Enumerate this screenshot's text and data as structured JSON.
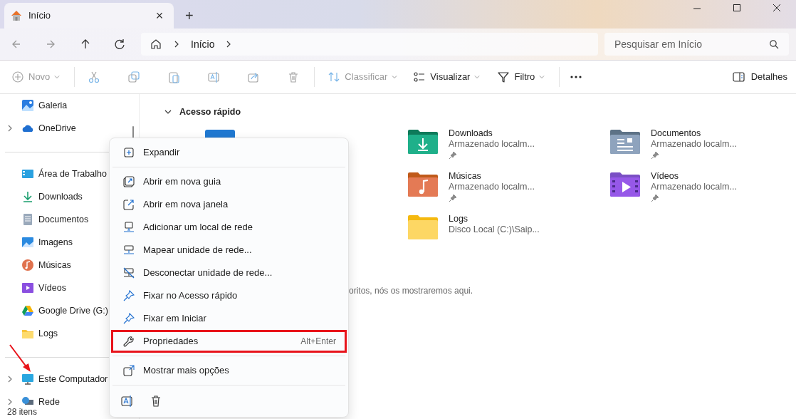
{
  "tab": {
    "title": "Início",
    "close": "×"
  },
  "new_tab": "+",
  "address": {
    "crumbs": [
      "Início"
    ]
  },
  "search": {
    "placeholder": "Pesquisar em Início"
  },
  "toolbar": [
    {
      "label": "Novo",
      "disabled": true,
      "dropdown": true
    },
    {
      "disabled": true,
      "dropdown": false
    },
    {
      "disabled": true,
      "dropdown": false
    },
    {
      "disabled": true,
      "dropdown": false
    },
    {
      "disabled": true,
      "dropdown": false
    },
    {
      "disabled": true,
      "dropdown": false
    },
    {
      "disabled": true,
      "dropdown": false
    },
    {
      "label": "Classificar",
      "disabled": true,
      "dropdown": true
    },
    {
      "label": "Visualizar",
      "disabled": false,
      "dropdown": true
    },
    {
      "label": "Filtro",
      "disabled": false,
      "dropdown": true
    }
  ],
  "details_button": "Detalhes",
  "sidebar": {
    "groups": [
      [
        {
          "label": "Galeria",
          "expandable": false
        },
        {
          "label": "OneDrive",
          "expandable": true
        }
      ],
      [
        {
          "label": "Área de Trabalho",
          "expandable": false
        },
        {
          "label": "Downloads",
          "expandable": false
        },
        {
          "label": "Documentos",
          "expandable": false
        },
        {
          "label": "Imagens",
          "expandable": false
        },
        {
          "label": "Músicas",
          "expandable": false
        },
        {
          "label": "Vídeos",
          "expandable": false
        },
        {
          "label": "Google Drive (G:)",
          "expandable": false
        },
        {
          "label": "Logs",
          "expandable": false
        }
      ],
      [
        {
          "label": "Este Computador",
          "expandable": true
        },
        {
          "label": "Rede",
          "expandable": true
        }
      ]
    ]
  },
  "status_bar": "28 itens",
  "quick_access": {
    "title": "Acesso rápido",
    "expanded": true,
    "tiles": [
      {
        "name": "Downloads",
        "subtitle": "Armazenado localm...",
        "pinned": true
      },
      {
        "name": "Documentos",
        "subtitle": "Armazenado localm...",
        "pinned": true
      },
      {
        "name": "Músicas",
        "subtitle": "Armazenado localm...",
        "pinned": true
      },
      {
        "name": "Vídeos",
        "subtitle": "Armazenado localm...",
        "pinned": true
      },
      {
        "name": "Logs",
        "subtitle": "Disco Local (C:)\\Saip...",
        "pinned": false
      }
    ]
  },
  "favorites_hint": "oritos, nós os mostraremos aqui.",
  "context_menu": {
    "sections": [
      [
        {
          "label": "Expandir",
          "highlighted": false
        }
      ],
      [
        {
          "label": "Abrir em nova guia",
          "highlighted": false
        },
        {
          "label": "Abrir em nova janela",
          "highlighted": false
        },
        {
          "label": "Adicionar um local de rede",
          "highlighted": false
        },
        {
          "label": "Mapear unidade de rede...",
          "highlighted": false
        },
        {
          "label": "Desconectar unidade de rede...",
          "highlighted": false
        },
        {
          "label": "Fixar no Acesso rápido",
          "highlighted": false
        },
        {
          "label": "Fixar em Iniciar",
          "highlighted": false
        },
        {
          "label": "Propriedades",
          "shortcut": "Alt+Enter",
          "highlighted": true
        }
      ],
      [
        {
          "label": "Mostrar mais opções",
          "highlighted": false
        }
      ]
    ]
  }
}
